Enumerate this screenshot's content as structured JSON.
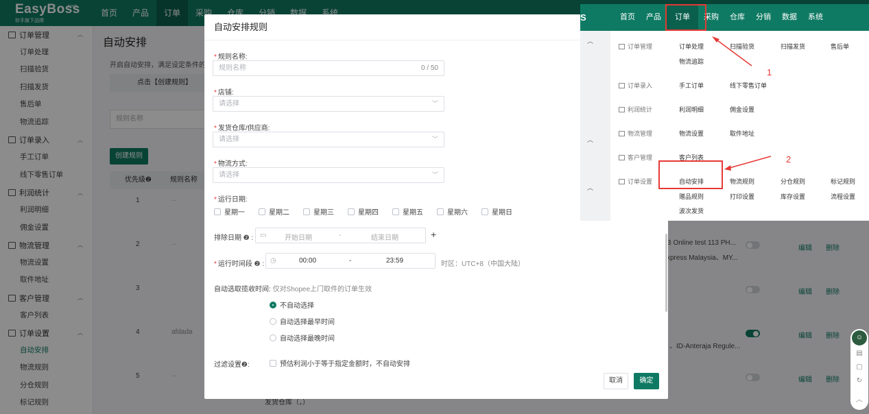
{
  "brand": {
    "name": "EasyBoss",
    "com": ".com",
    "subtitle": "妙手旗下品牌"
  },
  "top_nav": [
    "首页",
    "产品",
    "订单",
    "采购",
    "仓库",
    "分销",
    "数据",
    "系统"
  ],
  "sidebar": {
    "groups": [
      {
        "label": "订单管理",
        "items": [
          "订单处理",
          "扫描验货",
          "扫描发货",
          "售后单",
          "物流追踪"
        ]
      },
      {
        "label": "订单录入",
        "items": [
          "手工订单",
          "线下零售订单"
        ]
      },
      {
        "label": "利润统计",
        "items": [
          "利润明细",
          "佣金设置"
        ]
      },
      {
        "label": "物流管理",
        "items": [
          "物流设置",
          "取件地址"
        ]
      },
      {
        "label": "客户管理",
        "items": [
          "客户列表"
        ]
      },
      {
        "label": "订单设置",
        "items": [
          "自动安排",
          "物流规则",
          "分仓规则",
          "标记规则"
        ]
      }
    ],
    "active_item": "自动安排"
  },
  "page": {
    "title": "自动安排",
    "tip": "开启自动安排，满足设定条件的订",
    "banner": "点击【创建规则】",
    "search_placeholder": "规则名称",
    "create_button": "创建规则",
    "table_headers": {
      "priority": "优先级❷",
      "rule_name": "规则名称"
    },
    "rows": [
      {
        "priority": "1",
        "rule_name": "··",
        "toggle": false
      },
      {
        "priority": "2",
        "rule_name": "··",
        "toggle": false,
        "detail1": "B Online test 113 PH...",
        "detail2": "xpress Malaysia、MY..."
      },
      {
        "priority": "3",
        "rule_name": "",
        "toggle": false
      },
      {
        "priority": "4",
        "rule_name": "afdada",
        "toggle": true,
        "detail1": "、ID-Anteraja Regule..."
      },
      {
        "priority": "5",
        "rule_name": "··",
        "toggle": false
      }
    ],
    "action_edit": "编辑",
    "action_delete": "删除",
    "bottom_text": "发货仓库（，）"
  },
  "modal": {
    "title": "自动安排规则",
    "rule_name": {
      "label": "规则名称:",
      "placeholder": "规则名称",
      "count": "0 / 50"
    },
    "shop": {
      "label": "店铺:",
      "placeholder": "请选择"
    },
    "warehouse": {
      "label": "发货仓库/供应商:",
      "placeholder": "请选择"
    },
    "logistics": {
      "label": "物流方式:",
      "placeholder": "请选择"
    },
    "run_days": {
      "label": "运行日期:",
      "days": [
        "星期一",
        "星期二",
        "星期三",
        "星期四",
        "星期五",
        "星期六",
        "星期日"
      ]
    },
    "exclude_dates": {
      "label": "排除日期 ❷ :",
      "start": "开始日期",
      "sep": "-",
      "end": "结束日期",
      "add": "+"
    },
    "run_time": {
      "label": "运行时间段 ❷ :",
      "start": "00:00",
      "sep": "-",
      "end": "23:59",
      "tz": "时区：UTC+8（中国大陆）"
    },
    "pickup": {
      "label": "自动选取揽收时间:",
      "note": "仅对Shopee上门取件的订单生效",
      "options": [
        "不自动选择",
        "自动选择最早时间",
        "自动选择最晚时间"
      ],
      "selected": 0
    },
    "filter": {
      "label": "过滤设置❷:",
      "option": "预估利润小于等于指定金额时，不自动安排"
    },
    "cancel": "取消",
    "confirm": "确定"
  },
  "annotation": {
    "logo_fragment": "S",
    "nav": [
      "首页",
      "产品",
      "订单",
      "采购",
      "仓库",
      "分销",
      "数据",
      "系统"
    ],
    "selected_nav": "订单",
    "menu": [
      {
        "group": "订单管理",
        "links": [
          "订单处理",
          "扫描验货",
          "扫描发货",
          "售后单",
          "物流追踪"
        ]
      },
      {
        "group": "订单录入",
        "links": [
          "手工订单",
          "线下零售订单"
        ]
      },
      {
        "group": "利润统计",
        "links": [
          "利润明细",
          "佣金设置"
        ]
      },
      {
        "group": "物流管理",
        "links": [
          "物流设置",
          "取件地址"
        ]
      },
      {
        "group": "客户管理",
        "links": [
          "客户列表"
        ]
      },
      {
        "group": "订单设置",
        "links": [
          "自动安排",
          "物流规则",
          "分仓规则",
          "标记规则",
          "赠品规则",
          "打印设置",
          "库存设置",
          "流程设置",
          "波次发货"
        ]
      }
    ],
    "step1": "1",
    "step2": "2",
    "accent": "#e53935"
  },
  "colors": {
    "brand_green": "#0f7a63",
    "dark_green": "#0b604d",
    "annotation_red": "#e53935"
  }
}
